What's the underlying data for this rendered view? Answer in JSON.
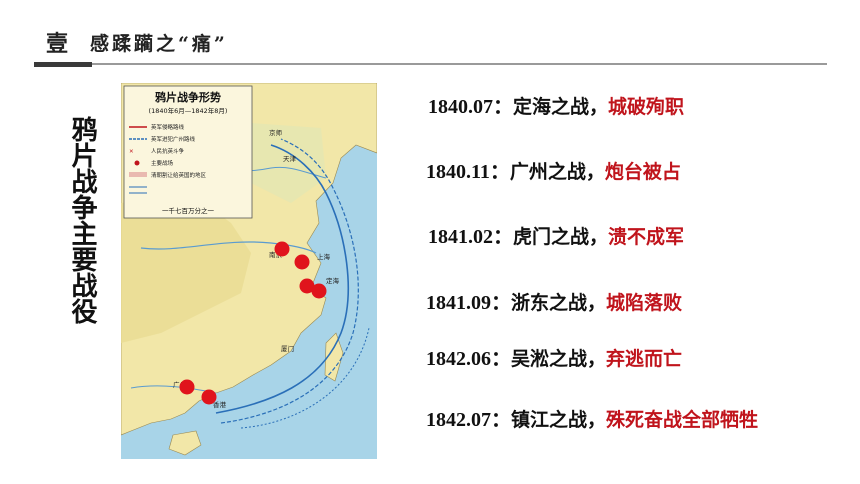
{
  "header": {
    "section_number": "壹",
    "title": "感蹂躏之“痛”"
  },
  "side_title": "鸦片战争主要战役",
  "map": {
    "title": "鸦片战争形势",
    "subtitle": "(1840年6月—1842年8月)",
    "scale": "一千七百万分之一",
    "legend": [
      "英军侵略路线",
      "英军进犯广州路线",
      "人民抗英斗争",
      "主要战场",
      "清朝割让给英国的地区"
    ],
    "labels": [
      "京师",
      "天津",
      "广州",
      "香港",
      "南京",
      "定海",
      "厦门",
      "上海"
    ],
    "colors": {
      "sea": "#a8d4e8",
      "land": "#f2e7a8",
      "land2": "#e9dc92",
      "route": "#2a6fb8",
      "marker": "#e0141c"
    }
  },
  "events": [
    {
      "date": "1840.07：",
      "place": "定海之战，",
      "result": "城破殉职"
    },
    {
      "date": "1840.11：",
      "place": "广州之战，",
      "result": "炮台被占"
    },
    {
      "date": "1841.02：",
      "place": "虎门之战，",
      "result": "溃不成军"
    },
    {
      "date": "1841.09：",
      "place": "浙东之战，",
      "result": "城陷落败"
    },
    {
      "date": "1842.06：",
      "place": "吴淞之战，",
      "result": "弃逃而亡"
    },
    {
      "date": "1842.07：",
      "place": "镇江之战，",
      "result": "殊死奋战全部牺牲"
    }
  ]
}
